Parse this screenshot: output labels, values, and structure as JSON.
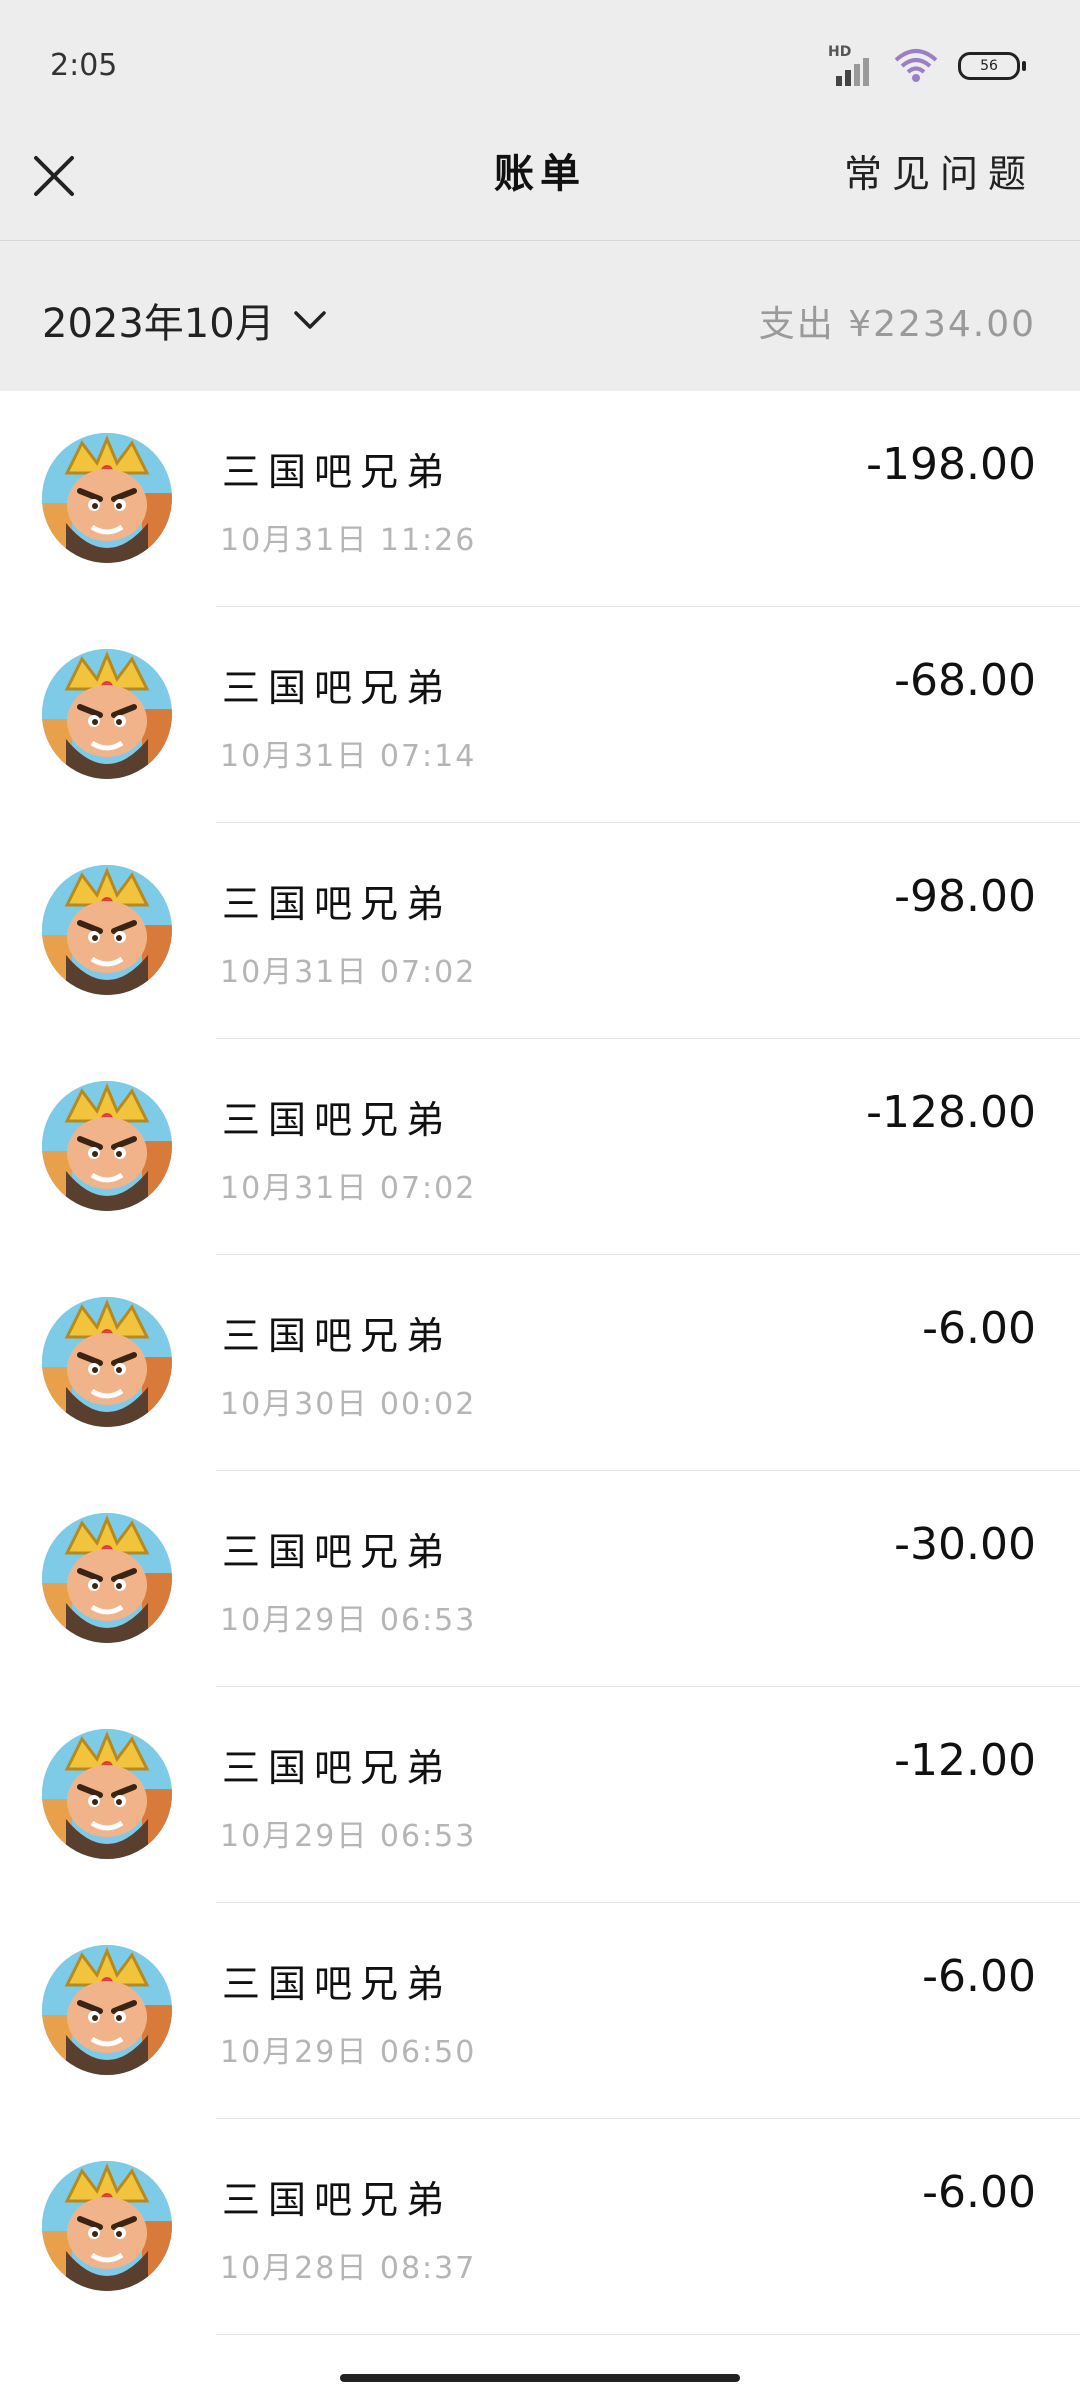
{
  "status_bar": {
    "time": "2:05",
    "network_label": "HD",
    "battery": "56"
  },
  "nav": {
    "title": "账单",
    "faq": "常见问题"
  },
  "filter": {
    "month": "2023年10月",
    "summary": "支出 ¥2234.00"
  },
  "transactions": [
    {
      "merchant": "三国吧兄弟",
      "datetime": "10月31日 11:26",
      "amount": "-198.00"
    },
    {
      "merchant": "三国吧兄弟",
      "datetime": "10月31日 07:14",
      "amount": "-68.00"
    },
    {
      "merchant": "三国吧兄弟",
      "datetime": "10月31日 07:02",
      "amount": "-98.00"
    },
    {
      "merchant": "三国吧兄弟",
      "datetime": "10月31日 07:02",
      "amount": "-128.00"
    },
    {
      "merchant": "三国吧兄弟",
      "datetime": "10月30日 00:02",
      "amount": "-6.00"
    },
    {
      "merchant": "三国吧兄弟",
      "datetime": "10月29日 06:53",
      "amount": "-30.00"
    },
    {
      "merchant": "三国吧兄弟",
      "datetime": "10月29日 06:53",
      "amount": "-12.00"
    },
    {
      "merchant": "三国吧兄弟",
      "datetime": "10月29日 06:50",
      "amount": "-6.00"
    },
    {
      "merchant": "三国吧兄弟",
      "datetime": "10月28日 08:37",
      "amount": "-6.00"
    }
  ],
  "icons": {
    "close": "close-icon",
    "chevron": "chevron-down-icon",
    "wifi": "wifi-icon",
    "signal": "signal-icon",
    "battery": "battery-icon",
    "avatar": "game-avatar-image"
  }
}
